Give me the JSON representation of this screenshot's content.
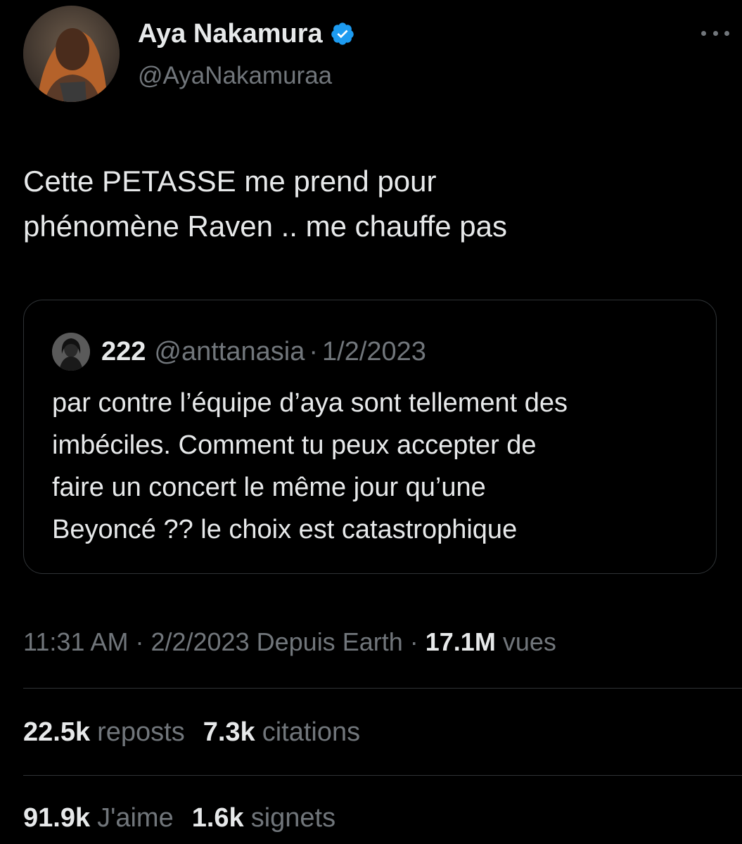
{
  "author": {
    "name": "Aya Nakamura",
    "handle": "@AyaNakamuraa",
    "verified_color": "#1d9bf0"
  },
  "icons": {
    "more": "more-dots-icon",
    "verified": "verified-badge-icon"
  },
  "tweet": {
    "text": "Cette PETASSE me prend pour\nphénomène Raven .. me chauffe pas"
  },
  "quoted_tweet": {
    "name": "222",
    "handle": "@anttanasia",
    "separator": "·",
    "date": "1/2/2023",
    "text": "par contre l’équipe d’aya sont tellement des\nimbéciles. Comment tu peux accepter de\nfaire un concert le même jour qu’une\nBeyoncé ?? le choix est catastrophique"
  },
  "meta": {
    "time": "11:31 AM",
    "separator": "·",
    "date": "2/2/2023",
    "source": "Depuis Earth",
    "views_count": "17.1M",
    "views_label": "vues"
  },
  "stats": {
    "reposts_count": "22.5k",
    "reposts_label": "reposts",
    "quotes_count": "7.3k",
    "quotes_label": "citations",
    "likes_count": "91.9k",
    "likes_label": "J'aime",
    "bookmarks_count": "1.6k",
    "bookmarks_label": "signets"
  },
  "colors": {
    "background": "#000000",
    "primary_text": "#e7e9ea",
    "secondary_text": "#71767b",
    "border": "#2f3336"
  }
}
